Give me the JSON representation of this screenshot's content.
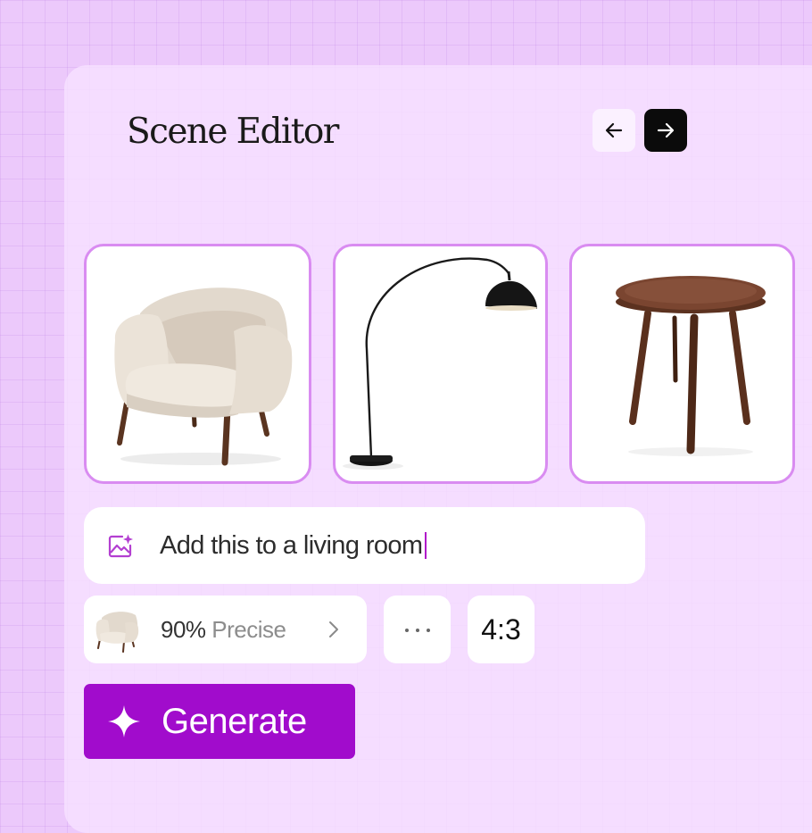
{
  "header": {
    "title": "Scene Editor",
    "nav": {
      "prev_icon": "arrow-left-icon",
      "next_icon": "arrow-right-icon"
    }
  },
  "products": [
    {
      "name": "armchair",
      "icon": "armchair-image"
    },
    {
      "name": "floor-lamp",
      "icon": "arc-floor-lamp-image"
    },
    {
      "name": "side-table",
      "icon": "round-side-table-image"
    }
  ],
  "prompt": {
    "icon": "image-sparkle-icon",
    "text": "Add this to a living room"
  },
  "reference": {
    "percent": "90%",
    "mode": "Precise",
    "icon": "chevron-right-icon"
  },
  "more": {
    "icon": "ellipsis-icon"
  },
  "aspect_ratio": "4:3",
  "generate": {
    "label": "Generate",
    "icon": "sparkle-icon"
  },
  "colors": {
    "background": "#ecc9fb",
    "accent": "#a10ccc",
    "card_border": "#d98cf1"
  }
}
